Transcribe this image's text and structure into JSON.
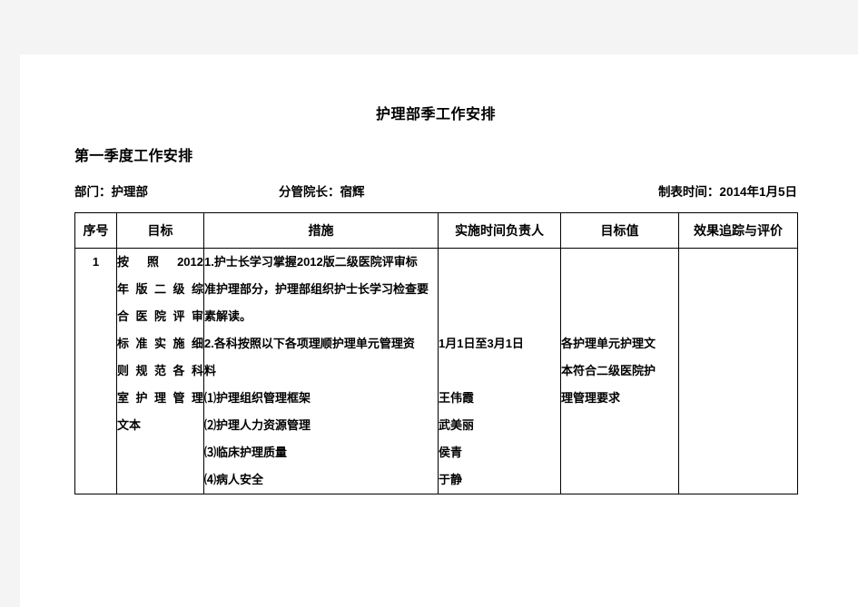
{
  "document": {
    "title": "护理部季工作安排",
    "section_title": "第一季度工作安排",
    "meta": {
      "department_label": "部门：护理部",
      "director_label": "分管院长：宿辉",
      "date_label": "制表时间：2014年1月5日"
    }
  },
  "table": {
    "headers": {
      "no": "序号",
      "goal": "目标",
      "measures": "措施",
      "time_owner": "实施时间负责人",
      "target_value": "目标值",
      "evaluation": "效果追踪与评价"
    },
    "rows": [
      {
        "no": "1",
        "goal_lines": [
          "按照2012",
          "年版二级综",
          "合医院评审",
          "标准实施细",
          "则规范各科",
          "室护理管理",
          "文本"
        ],
        "measures_lines": [
          "1.护士长学习掌握2012版二级医院评审标",
          "准护理部分，护理部组织护士长学习检查要",
          "素解读。",
          "2.各科按照以下各项理顺护理单元管理资",
          "料",
          "⑴护理组织管理框架",
          "⑵护理人力资源管理",
          "⑶临床护理质量",
          "⑷病人安全"
        ],
        "time_owner_lines": [
          "",
          "",
          "",
          "1月1日至3月1日",
          "",
          "王伟霞",
          "武美丽",
          "侯青",
          "于静"
        ],
        "target_value_lines": [
          "",
          "",
          "",
          "各护理单元护理文",
          "本符合二级医院护",
          "理管理要求"
        ],
        "evaluation_lines": []
      }
    ]
  },
  "colors": {
    "page_background": "#ffffff",
    "canvas_background": "#f4f4f4",
    "text": "#000000",
    "border": "#000000"
  }
}
